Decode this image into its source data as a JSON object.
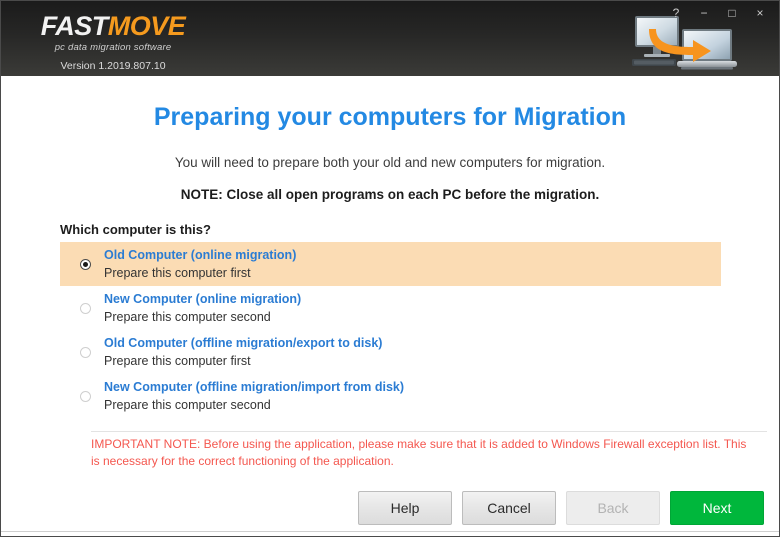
{
  "window": {
    "controls": [
      {
        "name": "help-button",
        "glyph": "?"
      },
      {
        "name": "minimize-button",
        "glyph": "−"
      },
      {
        "name": "maximize-button",
        "glyph": "□"
      },
      {
        "name": "close-button",
        "glyph": "×"
      }
    ]
  },
  "branding": {
    "logo_part1": "FAST",
    "logo_part2": "MOVE",
    "tagline": "pc data migration software",
    "version": "Version 1.2019.807.10",
    "logo_color_primary": "#f2f2f2",
    "logo_color_accent": "#f59a1e"
  },
  "header": {
    "title": "Preparing your computers for Migration",
    "title_color": "#2389e3",
    "subtitle": "You will need to prepare both your old and new computers for migration.",
    "note": "NOTE: Close all open programs on each PC before the migration."
  },
  "options": {
    "question": "Which computer is this?",
    "highlight_color": "#fbdcb4",
    "items": [
      {
        "title": "Old Computer (online migration)",
        "desc": "Prepare this computer first",
        "selected": true
      },
      {
        "title": "New Computer (online migration)",
        "desc": "Prepare this computer second",
        "selected": false
      },
      {
        "title": "Old Computer (offline migration/export to disk)",
        "desc": "Prepare this computer first",
        "selected": false
      },
      {
        "title": "New Computer (offline migration/import from disk)",
        "desc": "Prepare this computer second",
        "selected": false
      }
    ]
  },
  "important_note": {
    "text": "IMPORTANT NOTE: Before using the application, please make sure that it is added to Windows Firewall exception list. This is necessary for the correct functioning of the application.",
    "color": "#f4574f"
  },
  "footer": {
    "buttons": [
      {
        "name": "help-button",
        "label": "Help",
        "style": "grey",
        "disabled": false
      },
      {
        "name": "cancel-button",
        "label": "Cancel",
        "style": "grey",
        "disabled": false
      },
      {
        "name": "back-button",
        "label": "Back",
        "style": "disabled",
        "disabled": true
      },
      {
        "name": "next-button",
        "label": "Next",
        "style": "green",
        "disabled": false
      }
    ],
    "next_color": "#00b73c"
  }
}
